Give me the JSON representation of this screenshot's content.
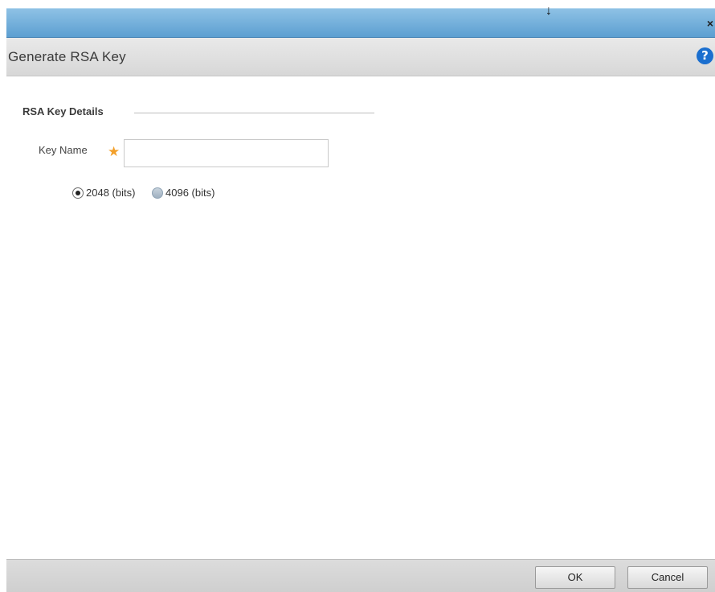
{
  "titlebar": {
    "close_symbol": "×",
    "drag_symbol": "↓"
  },
  "dialog": {
    "title": "Generate RSA Key",
    "help_symbol": "?"
  },
  "section": {
    "title": "RSA Key Details"
  },
  "key_name": {
    "label": "Key Name",
    "required_marker": "★",
    "value": "",
    "placeholder": ""
  },
  "key_size": {
    "selected": "2048 (bits)",
    "options": [
      {
        "label": "2048 (bits)",
        "checked": true
      },
      {
        "label": "4096 (bits)",
        "checked": false
      }
    ]
  },
  "footer": {
    "ok_label": "OK",
    "cancel_label": "Cancel"
  },
  "colors": {
    "titlebar": "#6aa9d8",
    "help": "#1b6fcf",
    "required": "#f3a02a"
  }
}
